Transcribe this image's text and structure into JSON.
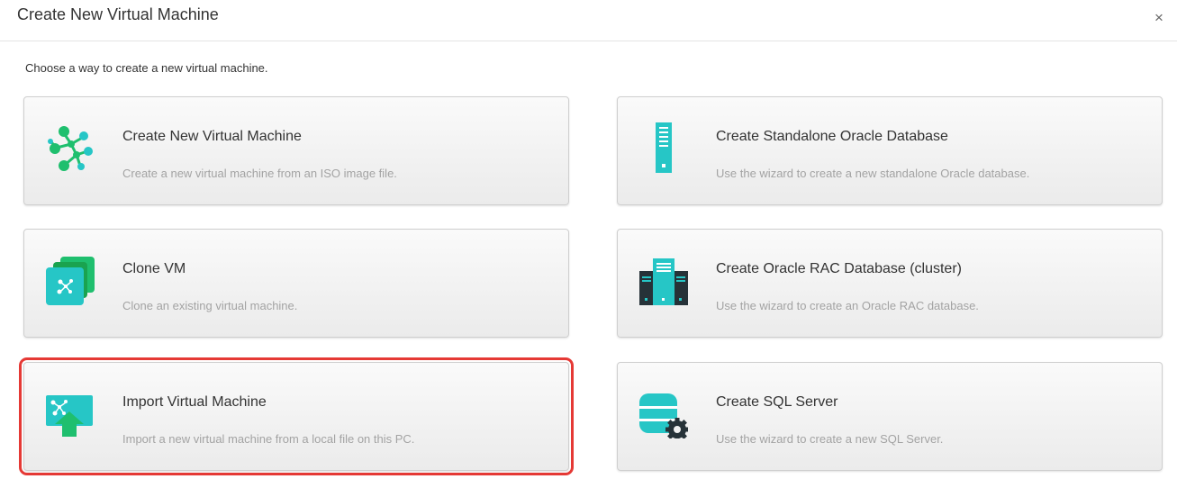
{
  "dialog": {
    "title": "Create New Virtual Machine",
    "close_glyph": "×",
    "intro": "Choose a way to create a new virtual machine."
  },
  "options": [
    {
      "title": "Create New Virtual Machine",
      "desc": "Create a new virtual machine from an ISO image file.",
      "icon": "network-nodes-icon"
    },
    {
      "title": "Create Standalone Oracle Database",
      "desc": "Use the wizard to create a new standalone Oracle database.",
      "icon": "server-icon"
    },
    {
      "title": "Clone VM",
      "desc": "Clone an existing virtual machine.",
      "icon": "clone-icon"
    },
    {
      "title": "Create Oracle RAC Database (cluster)",
      "desc": "Use the wizard to create an Oracle RAC database.",
      "icon": "server-cluster-icon"
    },
    {
      "title": "Import Virtual Machine",
      "desc": "Import a new virtual machine from a local file on this PC.",
      "icon": "import-icon",
      "selected": true
    },
    {
      "title": "Create SQL Server",
      "desc": "Use the wizard to create a new SQL Server.",
      "icon": "database-gear-icon"
    }
  ],
  "colors": {
    "teal": "#26c6c6",
    "green": "#1fbf6e",
    "dark": "#263238",
    "highlight": "#e53935"
  }
}
